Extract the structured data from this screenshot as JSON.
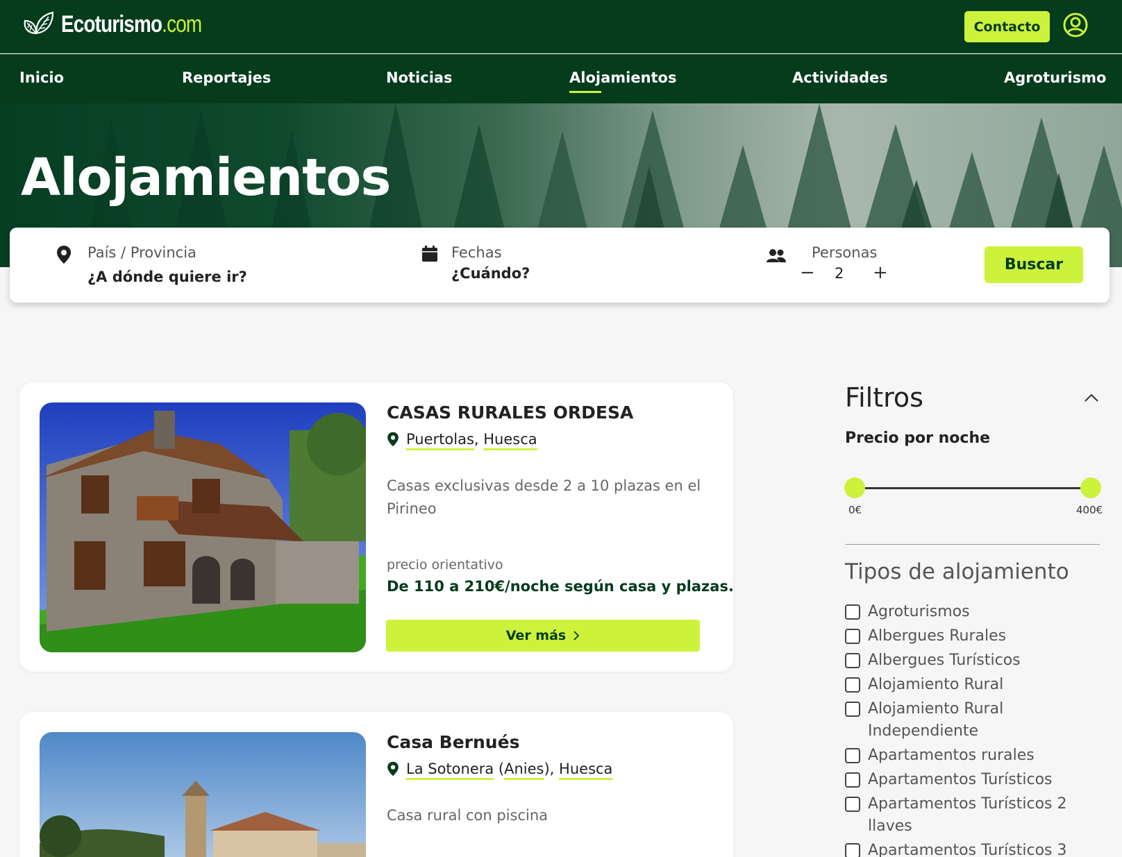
{
  "header": {
    "logo_main": "Ecoturismo",
    "logo_tld": ".com",
    "contact_label": "Contacto"
  },
  "nav": {
    "items": [
      {
        "label": "Inicio"
      },
      {
        "label": "Reportajes"
      },
      {
        "label": "Noticias"
      },
      {
        "label": "Alojamientos",
        "active": true
      },
      {
        "label": "Actividades"
      },
      {
        "label": "Agroturismo"
      }
    ]
  },
  "hero": {
    "title": "Alojamientos"
  },
  "search": {
    "location_label": "País / Provincia",
    "location_placeholder": "¿A dónde quiere ir?",
    "dates_label": "Fechas",
    "dates_placeholder": "¿Cuándo?",
    "people_label": "Personas",
    "people_minus": "−",
    "people_value": "2",
    "people_plus": "+",
    "button_label": "Buscar"
  },
  "listings": [
    {
      "title": "CASAS RURALES ORDESA",
      "location_parts": [
        "Puertolas",
        "Huesca"
      ],
      "description": "Casas exclusivas desde 2 a 10 plazas en el Pirineo",
      "price_label": "precio orientativo",
      "price": "De 110 a 210€/noche según casa y plazas.",
      "button_label": "Ver más"
    },
    {
      "title": "Casa Bernués",
      "location_parts": [
        "La Sotonera",
        "Anies",
        "Huesca"
      ],
      "description": "Casa rural con piscina"
    }
  ],
  "filters": {
    "title": "Filtros",
    "price_title": "Precio por noche",
    "price_min": "0€",
    "price_max": "400€",
    "price_range_selected": [
      0,
      400
    ],
    "types_title": "Tipos de alojamiento",
    "types": [
      {
        "label": "Agroturismos",
        "checked": false
      },
      {
        "label": "Albergues Rurales",
        "checked": false
      },
      {
        "label": "Albergues Turísticos",
        "checked": false
      },
      {
        "label": "Alojamiento Rural",
        "checked": false
      },
      {
        "label": "Alojamiento Rural Independiente",
        "checked": false
      },
      {
        "label": "Apartamentos rurales",
        "checked": false
      },
      {
        "label": "Apartamentos Turísticos",
        "checked": false
      },
      {
        "label": "Apartamentos Turísticos 2 llaves",
        "checked": false
      },
      {
        "label": "Apartamentos Turísticos 3",
        "checked": false
      }
    ]
  },
  "colors": {
    "brand_dark": "#053c1c",
    "accent": "#cdf23c"
  }
}
